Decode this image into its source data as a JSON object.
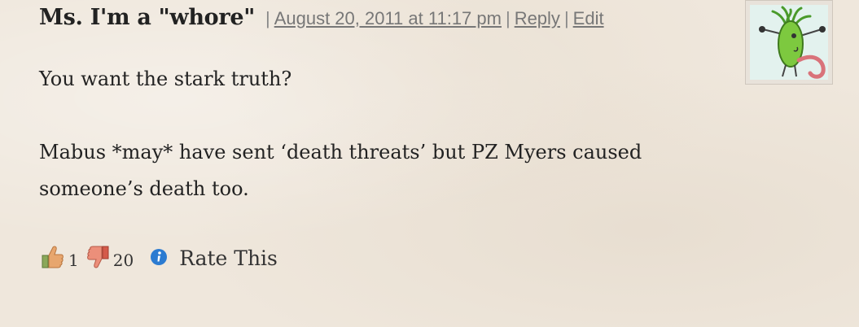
{
  "comment": {
    "author": "Ms. I'm a \"whore\"",
    "meta": {
      "separator": "|",
      "date": "August 20, 2011 at 11:17 pm",
      "reply_label": "Reply",
      "edit_label": "Edit"
    },
    "paragraphs": [
      "You want the stark truth?",
      "Mabus *may* have sent ‘death threats’ but PZ Myers caused someone’s death too."
    ],
    "rating": {
      "likes": "1",
      "dislikes": "20",
      "rate_label": "Rate This"
    },
    "avatar": {
      "icon": "green-cartoon-creature"
    }
  },
  "colors": {
    "background": "#efe7dc",
    "thumb_up": "#e7a66e",
    "thumb_down": "#e0705c",
    "info": "#2b7bd1",
    "avatar_green": "#7dc93f"
  }
}
